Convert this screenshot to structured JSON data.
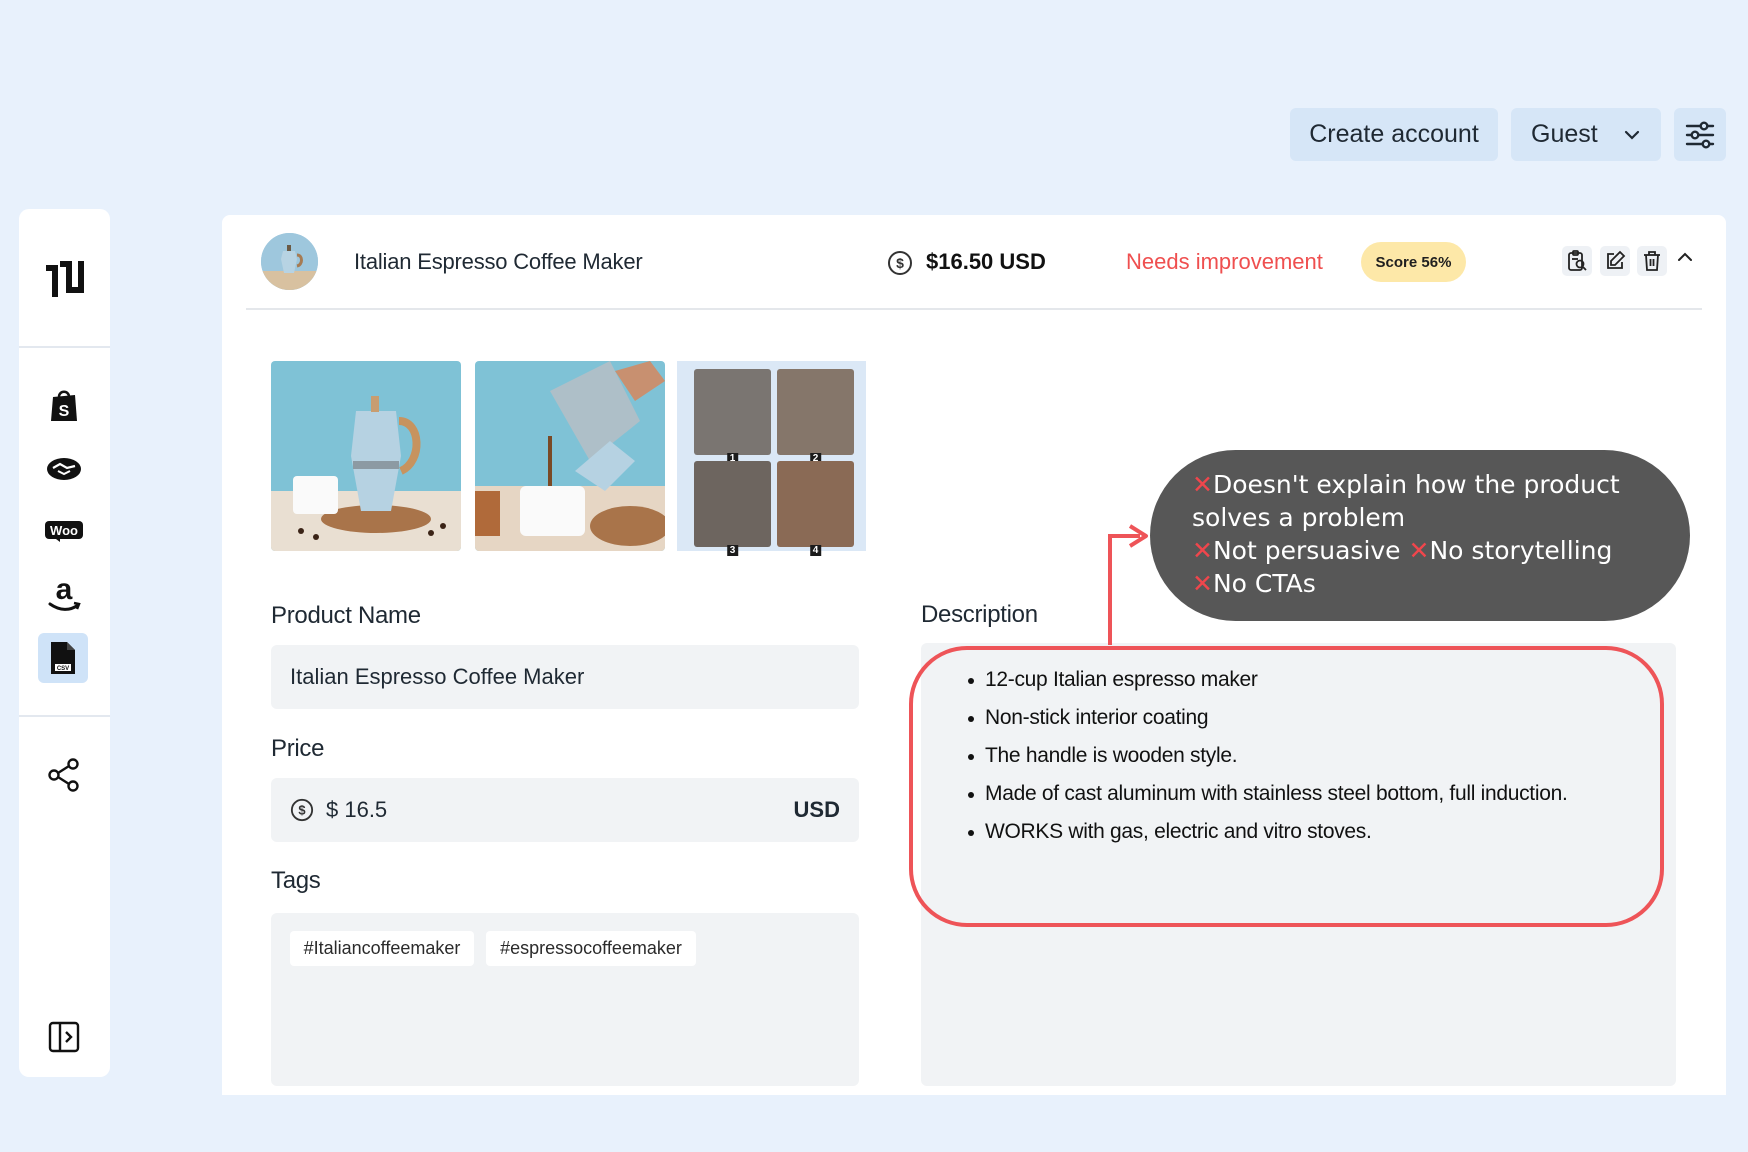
{
  "topbar": {
    "create_account": "Create account",
    "guest": "Guest"
  },
  "product": {
    "header_name": "Italian Espresso Coffee Maker",
    "header_price": "$16.50 USD",
    "status": "Needs improvement",
    "score": "Score 56%"
  },
  "images": {
    "grid_numbers": [
      "1",
      "2",
      "3",
      "4"
    ]
  },
  "form": {
    "name_label": "Product Name",
    "name_value": "Italian Espresso Coffee Maker",
    "price_label": "Price",
    "price_value": "$ 16.5",
    "currency": "USD",
    "tags_label": "Tags",
    "tags": [
      "#Italiancoffeemaker",
      "#espressocoffeemaker"
    ],
    "description_label": "Description",
    "description_items": [
      "12-cup Italian espresso maker",
      "Non-stick interior coating",
      "The handle is wooden style.",
      "Made of cast aluminum with stainless steel bottom, full induction.",
      "WORKS with gas, electric and vitro stoves."
    ]
  },
  "callout": {
    "line1": "Doesn't explain how the product",
    "line2": "solves a problem",
    "line3a": "Not persuasive",
    "line3b": "No storytelling",
    "line4": "No CTAs",
    "mark": "✕"
  },
  "colors": {
    "background": "#e8f1fc",
    "status_red": "#ef4f4f",
    "score_badge": "#fde8a8",
    "highlight": "#ee5458",
    "callout_bg": "#575757"
  }
}
